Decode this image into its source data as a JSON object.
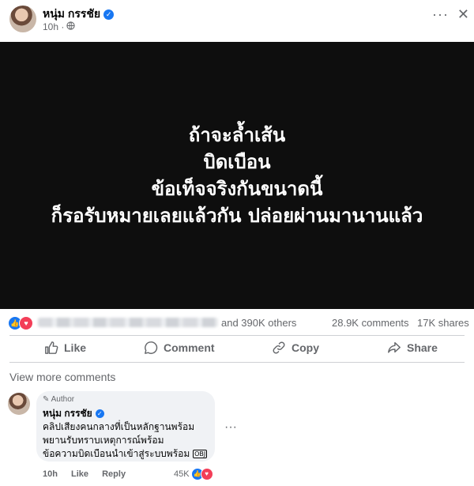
{
  "post": {
    "author": "หนุ่ม กรรชัย",
    "time": "10h",
    "more_icon": "ellipsis-icon",
    "close_icon": "close-icon"
  },
  "image_text": {
    "lines": [
      "ถ้าจะล้ำเส้น",
      "บิดเบือน",
      "ข้อเท็จจริงกันขนาดนี้",
      "ก็รอรับหมายเลยแล้วกัน ปล่อยผ่านมานานแล้ว"
    ]
  },
  "stats": {
    "others": "and 390K others",
    "comments": "28.9K comments",
    "shares": "17K shares"
  },
  "actions": {
    "like": "Like",
    "comment": "Comment",
    "copy": "Copy",
    "share": "Share"
  },
  "comments_section": {
    "view_more": "View more comments",
    "comment": {
      "badge": "Author",
      "name": "หนุ่ม กรรชัย",
      "line1": "คลิปเสียงคนกลางที่เป็นหลักฐานพร้อม",
      "line2": "พยานรับทราบเหตุการณ์พร้อม",
      "line3": "ข้อความบิดเบือนนำเข้าสู่ระบบพร้อม",
      "tag": "OBJ",
      "time": "10h",
      "like": "Like",
      "reply": "Reply",
      "reactions": "45K"
    }
  },
  "colors": {
    "brand_blue": "#1877f2",
    "love_red": "#f33e58",
    "image_bg": "#0e0e0e",
    "secondary_text": "#65676b"
  }
}
